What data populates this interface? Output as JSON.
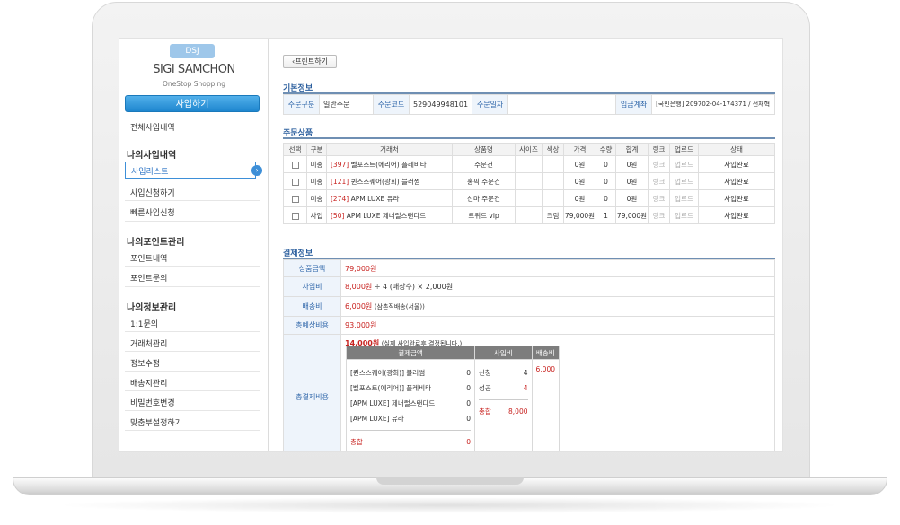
{
  "logo": {
    "badge": "DSJ",
    "name": "SIGI SAMCHON",
    "tagline": "OneStop Shopping"
  },
  "sidebar": {
    "buy_button": "사입하기",
    "all_history": "전체사입내역",
    "group1": {
      "title": "나의사입내역",
      "items": [
        "사입리스트",
        "사입신청하기",
        "빠른사입신청"
      ]
    },
    "group2": {
      "title": "나의포인트관리",
      "items": [
        "포인트내역",
        "포인트문의"
      ]
    },
    "group3": {
      "title": "나의정보관리",
      "items": [
        "1:1문의",
        "거래처관리",
        "정보수정",
        "배송지관리",
        "비밀번호변경",
        "맞춤부설정하기"
      ]
    }
  },
  "main": {
    "print_button": "프린트하기",
    "basic": {
      "title": "기본정보",
      "order_type_label": "주문구분",
      "order_type": "일반주문",
      "order_code_label": "주문코드",
      "order_code": "529049948101",
      "order_date_label": "주문일자",
      "order_date": "",
      "deposit_label": "입금계좌",
      "deposit": "[국민은행] 209702-04-174371 / 전재혁"
    },
    "products": {
      "title": "주문상품",
      "headers": [
        "선택",
        "구분",
        "거래처",
        "상품명",
        "사이즈",
        "색상",
        "가격",
        "수량",
        "합계",
        "링크",
        "업로드",
        "상태"
      ],
      "rows": [
        {
          "kind": "미송",
          "code": "[397]",
          "store": "벨포스트(에리어) 플레비타",
          "product": "주문건",
          "size": "",
          "color": "",
          "price": "0원",
          "qty": "0",
          "total": "0원",
          "link": "링크",
          "upload": "업로드",
          "status": "사입완료"
        },
        {
          "kind": "미송",
          "code": "[121]",
          "store": "퀸스스퀘어(광희) 블러썸",
          "product": "홍픽 주문건",
          "size": "",
          "color": "",
          "price": "0원",
          "qty": "0",
          "total": "0원",
          "link": "링크",
          "upload": "업로드",
          "status": "사입완료"
        },
        {
          "kind": "미송",
          "code": "[274]",
          "store": "APM LUXE 유라",
          "product": "신마 주문건",
          "size": "",
          "color": "",
          "price": "0원",
          "qty": "0",
          "total": "0원",
          "link": "링크",
          "upload": "업로드",
          "status": "사입완료"
        },
        {
          "kind": "사입",
          "code": "[50]",
          "store": "APM LUXE 제너럴스탠다드",
          "product": "트위드 vip",
          "size": "",
          "color": "크림",
          "price": "79,000원",
          "qty": "1",
          "total": "79,000원",
          "link": "링크",
          "upload": "업로드",
          "status": "사입완료"
        }
      ]
    },
    "payment": {
      "title": "결제정보",
      "goods_label": "상품금액",
      "goods_amount": "79,000원",
      "fee_label": "사입비",
      "fee_amount": "8,000원",
      "fee_calc": "÷ 4 (매장수) × 2,000원",
      "ship_label": "배송비",
      "ship_amount": "6,000원",
      "ship_note": "(삼촌직배송(서울))",
      "expected_label": "총예상비용",
      "expected_amount": "93,000원",
      "total_label": "총결제비용",
      "total_amount": "14,000원",
      "total_note": "(실제 사입완료후 결정됩니다.)",
      "detail": {
        "pay_header": "결제금액",
        "fee_header": "사입비",
        "ship_header": "배송비",
        "stores": [
          {
            "name": "[퀸스스퀘어(광희)] 블러썸",
            "amount": "0"
          },
          {
            "name": "[벨포스트(에리어)] 플레비타",
            "amount": "0"
          },
          {
            "name": "[APM LUXE] 제너럴스탠다드",
            "amount": "0"
          },
          {
            "name": "[APM LUXE] 유라",
            "amount": "0"
          }
        ],
        "sum_label": "총합",
        "sum_value": "0",
        "apply_label": "신청",
        "apply_value": "4",
        "success_label": "성공",
        "success_value": "4",
        "fee_sum_label": "총합",
        "fee_sum_value": "8,000",
        "ship_value": "6,000"
      }
    }
  }
}
